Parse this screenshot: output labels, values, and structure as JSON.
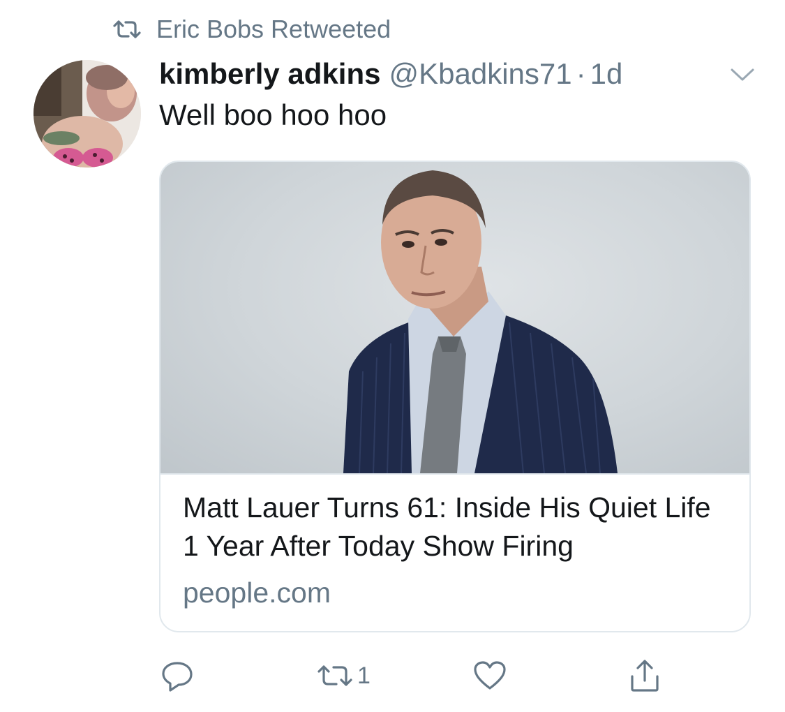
{
  "retweet_banner": {
    "icon": "retweet-icon",
    "text": "Eric Bobs Retweeted"
  },
  "tweet": {
    "author_name": "kimberly adkins",
    "handle": "@Kbadkins71",
    "separator": "·",
    "time": "1d",
    "text": "Well boo hoo hoo",
    "menu_icon": "chevron-down-icon"
  },
  "card": {
    "title": "Matt Lauer Turns 61: Inside His Quiet Life 1 Year After Today Show Firing",
    "domain": "people.com"
  },
  "actions": {
    "reply": {
      "icon": "reply-icon"
    },
    "retweet": {
      "icon": "retweet-icon",
      "count": "1"
    },
    "like": {
      "icon": "heart-icon"
    },
    "share": {
      "icon": "share-icon"
    }
  },
  "colors": {
    "text_primary": "#14171a",
    "text_secondary": "#657786",
    "border": "#e1e8ed",
    "suit": "#1f2a4a"
  }
}
